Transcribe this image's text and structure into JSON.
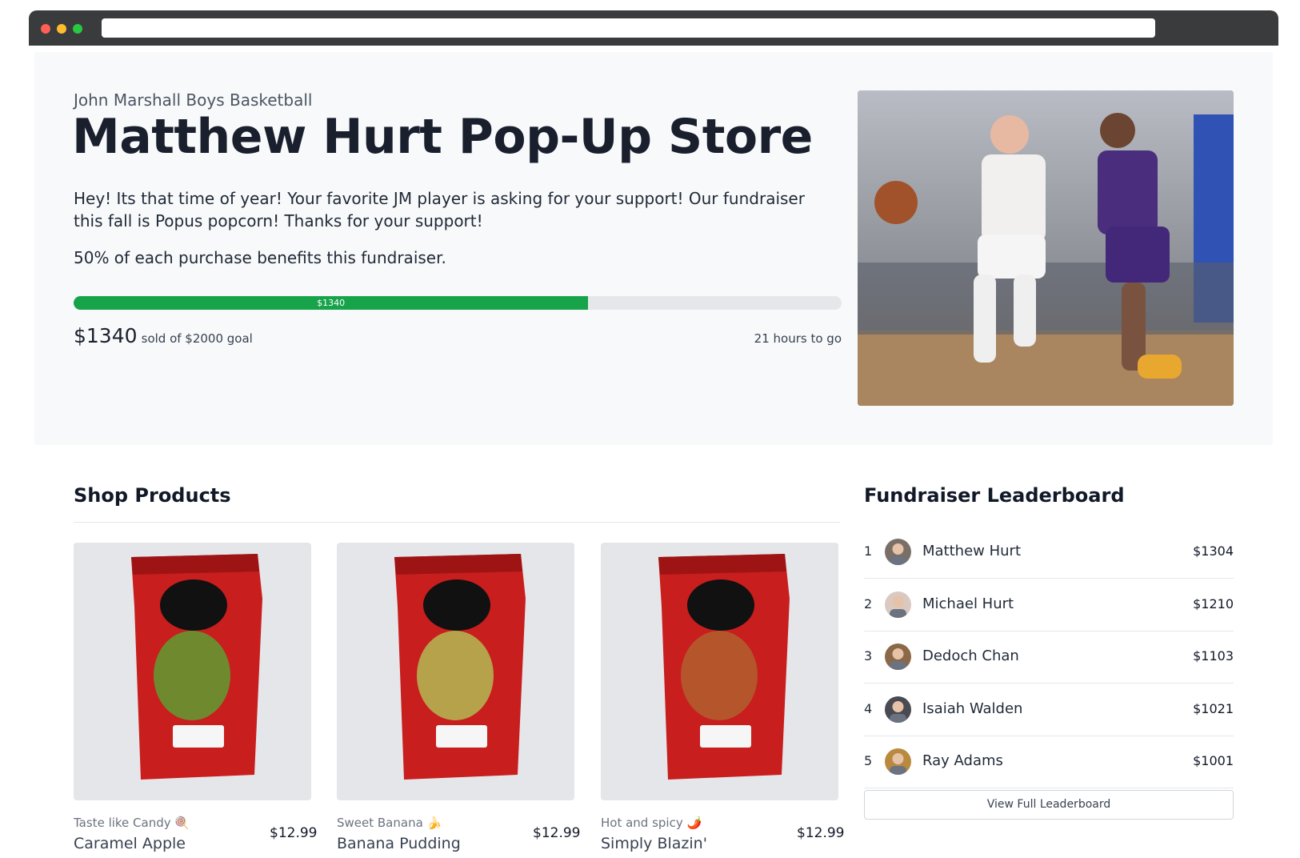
{
  "hero": {
    "team": "John Marshall Boys Basketball",
    "title": "Matthew Hurt Pop-Up Store",
    "description": "Hey! Its that time of year! Your favorite JM player is asking for your support! Our fundraiser this fall is Popus popcorn! Thanks for your support!",
    "benefit": "50% of each purchase benefits this fundraiser.",
    "progress": {
      "label": "$1340",
      "percent": 67
    },
    "raised": "$1340",
    "goal_text": "sold of $2000 goal",
    "time_left": "21 hours to go"
  },
  "shop": {
    "title": "Shop Products",
    "products": [
      {
        "tag": "Taste like Candy",
        "tag_emoji": "🍭",
        "name": "Caramel Apple",
        "price": "$12.99",
        "label": "Caramel Apple",
        "fill": "#6f8a2e"
      },
      {
        "tag": "Sweet Banana",
        "tag_emoji": "🍌",
        "name": "Banana Pudding",
        "price": "$12.99",
        "label": "Banana Pudding",
        "fill": "#b6a24a"
      },
      {
        "tag": "Hot and spicy",
        "tag_emoji": "🌶️",
        "name": "Simply Blazin'",
        "price": "$12.99",
        "label": "Simply Blazin",
        "fill": "#b4552b"
      }
    ]
  },
  "leaderboard": {
    "title": "Fundraiser Leaderboard",
    "entries": [
      {
        "rank": "1",
        "name": "Matthew Hurt",
        "amount": "$1304"
      },
      {
        "rank": "2",
        "name": "Michael Hurt",
        "amount": "$1210"
      },
      {
        "rank": "3",
        "name": "Dedoch Chan",
        "amount": "$1103"
      },
      {
        "rank": "4",
        "name": "Isaiah Walden",
        "amount": "$1021"
      },
      {
        "rank": "5",
        "name": "Ray Adams",
        "amount": "$1001"
      }
    ],
    "button_label": "View Full Leaderboard"
  },
  "colors": {
    "progress_fill": "#16a34a",
    "progress_track": "#e5e7eb",
    "hero_bg": "#f8f9fa",
    "popcorn_bag": "#c81e1e"
  }
}
